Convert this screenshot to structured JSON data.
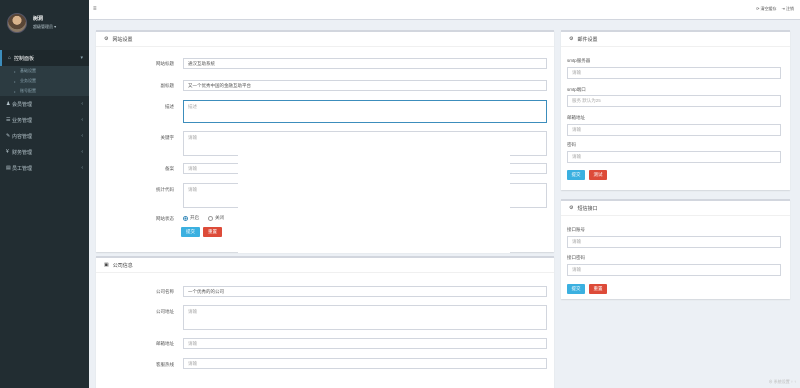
{
  "user": {
    "name": "树洞",
    "role": "超级管理员 ▾"
  },
  "sidebar": {
    "items": [
      {
        "icon": "⌂",
        "label": "控制面板",
        "arrow": "▾",
        "active": true
      },
      {
        "icon": "♟",
        "label": "会员管理",
        "arrow": "‹"
      },
      {
        "icon": "☰",
        "label": "业务管理",
        "arrow": "‹"
      },
      {
        "icon": "✎",
        "label": "内容管理",
        "arrow": "‹"
      },
      {
        "icon": "¥",
        "label": "财务管理",
        "arrow": "‹"
      },
      {
        "icon": "▤",
        "label": "员工管理",
        "arrow": "‹"
      }
    ],
    "sub_items": [
      "基础设置",
      "业务设置",
      "账号配置"
    ]
  },
  "topbar": {
    "menu_icon": "≡",
    "refresh": "⟳ 清空缓存",
    "logout": "⇥ 注销"
  },
  "site_settings": {
    "title": "网站设置",
    "fields": [
      {
        "label": "网站标题",
        "value": "通汉互助系统",
        "placeholder": ""
      },
      {
        "label": "副标题",
        "value": "又一个优秀中国的金融互助平台",
        "placeholder": ""
      },
      {
        "label": "描述",
        "value": "",
        "placeholder": "描述"
      },
      {
        "label": "关键字",
        "value": "",
        "placeholder": "请输"
      },
      {
        "label": "备案",
        "value": "",
        "placeholder": "请输"
      },
      {
        "label": "统计代码",
        "value": "",
        "placeholder": "请输"
      }
    ],
    "status_label": "网站状态",
    "status_options": [
      "开启",
      "关闭"
    ],
    "submit": "提交",
    "reset": "重置"
  },
  "company_info": {
    "title": "公司信息",
    "fields": [
      {
        "label": "公司名称",
        "value": "一个优秀的的公司",
        "placeholder": ""
      },
      {
        "label": "公司地址",
        "value": "",
        "placeholder": "请输"
      },
      {
        "label": "邮箱地址",
        "value": "",
        "placeholder": "请输"
      },
      {
        "label": "客服热线",
        "value": "",
        "placeholder": "请输"
      }
    ]
  },
  "mail_settings": {
    "title": "邮件设置",
    "fields": [
      {
        "label": "smtp服务器",
        "placeholder": "请输"
      },
      {
        "label": "smtp端口",
        "placeholder": "服务 默认为25"
      },
      {
        "label": "邮箱地址",
        "placeholder": "请输"
      },
      {
        "label": "密码",
        "placeholder": "请输"
      }
    ],
    "submit": "提交",
    "test": "测试"
  },
  "sms_settings": {
    "title": "短信接口",
    "fields": [
      {
        "label": "接口账号",
        "placeholder": "请输"
      },
      {
        "label": "接口密码",
        "placeholder": "请输"
      }
    ],
    "submit": "提交",
    "reset": "重置"
  },
  "footer": {
    "corner": "⊕ 系统设置 ↑ ↑"
  }
}
